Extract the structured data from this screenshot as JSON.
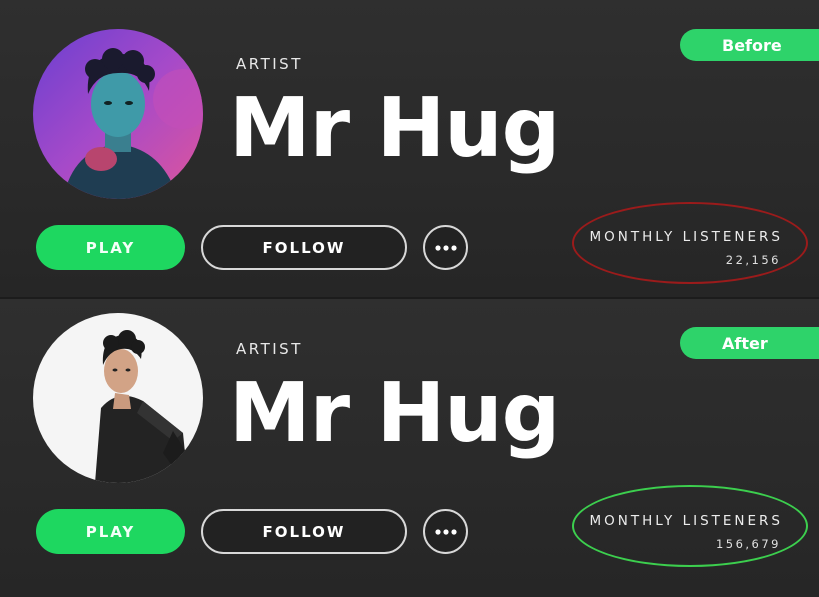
{
  "before": {
    "tag": "Before",
    "artist_label": "ARTIST",
    "artist_name": "Mr Hug",
    "play_label": "PLAY",
    "follow_label": "FOLLOW",
    "listeners_label": "MONTHLY LISTENERS",
    "listeners_value": "22,156",
    "highlight_color": "#9b1b1b"
  },
  "after": {
    "tag": "After",
    "artist_label": "ARTIST",
    "artist_name": "Mr Hug",
    "play_label": "PLAY",
    "follow_label": "FOLLOW",
    "listeners_label": "MONTHLY LISTENERS",
    "listeners_value": "156,679",
    "highlight_color": "#3ccf4e"
  },
  "colors": {
    "accent_green": "#1ed760",
    "tag_green": "#2ed36a",
    "background": "#2a2a2a"
  },
  "icons": {
    "more": "more-dots-icon"
  }
}
